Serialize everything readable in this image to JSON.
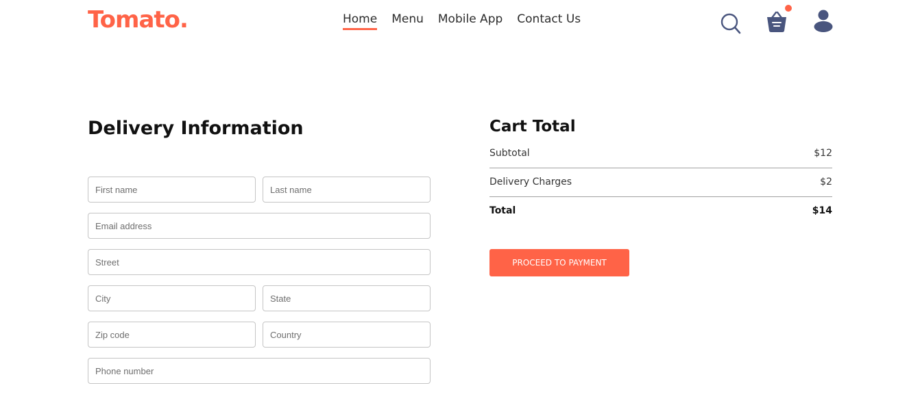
{
  "brand": {
    "logo": "Tomato.",
    "accent_color": "#ff6347"
  },
  "nav": {
    "items": [
      {
        "label": "Home",
        "active": true
      },
      {
        "label": "Menu",
        "active": false
      },
      {
        "label": "Mobile App",
        "active": false
      },
      {
        "label": "Contact Us",
        "active": false
      }
    ],
    "icons": [
      "search-icon",
      "basket-icon",
      "profile-icon"
    ],
    "cart_has_items": true
  },
  "delivery": {
    "title": "Delivery Information",
    "fields": {
      "first_name": "First name",
      "last_name": "Last name",
      "email": "Email address",
      "street": "Street",
      "city": "City",
      "state": "State",
      "zip": "Zip code",
      "country": "Country",
      "phone": "Phone number"
    }
  },
  "cart": {
    "title": "Cart Total",
    "subtotal_label": "Subtotal",
    "subtotal_value": "$12",
    "delivery_label": "Delivery Charges",
    "delivery_value": "$2",
    "total_label": "Total",
    "total_value": "$14",
    "button_label": "PROCEED TO PAYMENT"
  }
}
